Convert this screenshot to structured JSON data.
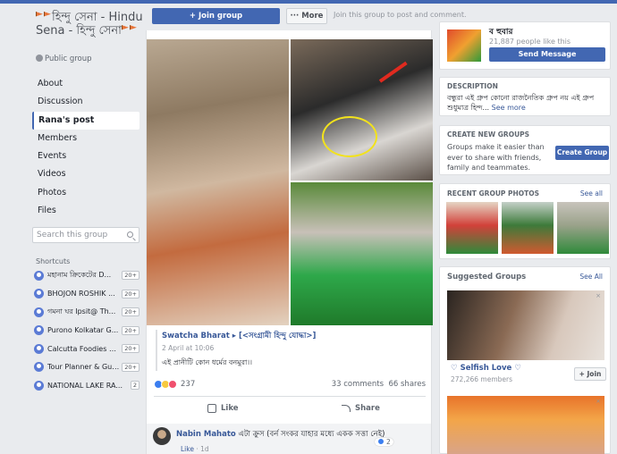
{
  "group": {
    "title": "হিন্দু সেনা - Hindu Sena - হিন্দু সেনা",
    "privacy": "Public group"
  },
  "nav": {
    "items": [
      "About",
      "Discussion",
      "Rana's post",
      "Members",
      "Events",
      "Videos",
      "Photos",
      "Files"
    ],
    "active": "Rana's post"
  },
  "search": {
    "placeholder": "Search this group"
  },
  "shortcuts": {
    "heading": "Shortcuts",
    "items": [
      {
        "label": "মহানাম ক্রিকেটের D...",
        "count": "20+"
      },
      {
        "label": "BHOJON ROSHIK ...",
        "count": "20+"
      },
      {
        "label": "গমনা ঘর Ipsit@ Th...",
        "count": "20+"
      },
      {
        "label": "Purono Kolkatar G...",
        "count": "20+"
      },
      {
        "label": "Calcutta Foodies C...",
        "count": "20+"
      },
      {
        "label": "Tour Planner & Guide",
        "count": "20+"
      },
      {
        "label": "NATIONAL LAKE RA...",
        "count": "2"
      }
    ]
  },
  "actionbar": {
    "join_label": "+ Join group",
    "more_label": "··· More",
    "hint": "Join this group to post and comment."
  },
  "post": {
    "shared_from": "Swatcha Bharat ▸ [<সংগ্রামী হিন্দু যোদ্ধা>]",
    "time": "2 April at 10:06",
    "text": "এই প্রানীটি কোন ধর্মের বনমুরা।।",
    "reactions_count": "237",
    "comments_label": "33 comments",
    "shares_label": "66 shares",
    "like_label": "Like",
    "share_label": "Share"
  },
  "comment": {
    "author": "Nabin Mahato",
    "text": "এটা ক্রুস (বর্ন সংকর যাহার মধ্যে একক সত্তা নেই)",
    "like_label": "Like",
    "age": "1d",
    "reaction_count": "2"
  },
  "page_box": {
    "name": "ব হুবার",
    "likes": "21,887 people like this",
    "message_label": "Send Message"
  },
  "description": {
    "heading": "DESCRIPTION",
    "text": "বন্ধুরা এই গ্রুপ কোনো রাজনৈতিক গ্রুপ নয় এই গ্রুপ শুধুমাত্র হিন্দ...",
    "see_more": "See more"
  },
  "create_groups": {
    "heading": "CREATE NEW GROUPS",
    "text": "Groups make it easier than ever to share with friends, family and teammates.",
    "button": "Create Group"
  },
  "recent_photos": {
    "heading": "RECENT GROUP PHOTOS",
    "see_all": "See all"
  },
  "suggested": {
    "heading": "Suggested Groups",
    "see_all": "See All",
    "name": "♡ Selfish Love ♡",
    "members": "272,266 members",
    "join_label": "+ Join",
    "close": "×"
  },
  "colors": {
    "primary": "#4267b2",
    "link": "#385898",
    "background": "#e9ebee"
  }
}
